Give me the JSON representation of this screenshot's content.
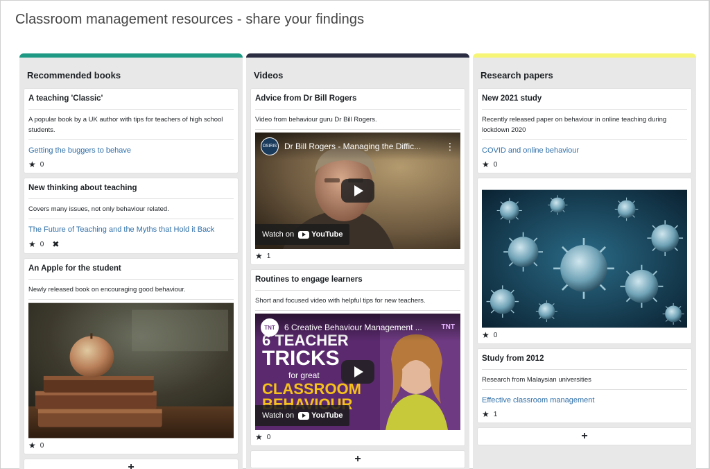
{
  "page": {
    "title": "Classroom management resources - share your findings"
  },
  "columns": [
    {
      "heading": "Recommended books",
      "color": "#1e9a84",
      "cards": [
        {
          "title": "A teaching 'Classic'",
          "description": "A popular book by a UK author with tips for teachers of high school students.",
          "link": "Getting the buggers to behave",
          "rating": "0"
        },
        {
          "title": "New thinking about teaching",
          "description": "Covers many issues, not only behaviour related.",
          "link": "The Future of Teaching and the Myths that Hold it Back",
          "rating": "0"
        },
        {
          "title": "An Apple for the student",
          "description": "Newly released book on encouraging good behaviour.",
          "rating": "0"
        }
      ],
      "add_label": "+"
    },
    {
      "heading": "Videos",
      "color": "#2b2d42",
      "cards": [
        {
          "title": "Advice from Dr Bill Rogers",
          "description": "Video from behaviour guru Dr Bill Rogers.",
          "video_title": "Dr Bill Rogers - Managing the Diffic...",
          "channel": "OSIRIS",
          "rating": "1"
        },
        {
          "title": "Routines to engage learners",
          "description": "Short and focused video with helpful tips for new teachers.",
          "video_title": "6 Creative Behaviour Management ...",
          "channel": "TNT",
          "thumb_text": [
            "6 TEACHER",
            "TRICKS",
            "for great",
            "CLASSROOM",
            "BEHAVIOUR"
          ],
          "rating": "0"
        }
      ],
      "watch_on": "Watch on",
      "youtube": "YouTube",
      "add_label": "+"
    },
    {
      "heading": "Research papers",
      "color": "#f7f575",
      "cards": [
        {
          "title": "New 2021 study",
          "description": "Recently released paper on behaviour in online teaching during lockdown 2020",
          "link": "COVID and online behaviour",
          "rating": "0"
        },
        {
          "rating": "0"
        },
        {
          "title": "Study from 2012",
          "description": "Research from Malaysian universities",
          "link": "Effective classroom management",
          "rating": "1"
        }
      ],
      "add_label": "+"
    }
  ],
  "icons": {
    "star": "★",
    "close": "✖",
    "kebab": "⋮"
  }
}
